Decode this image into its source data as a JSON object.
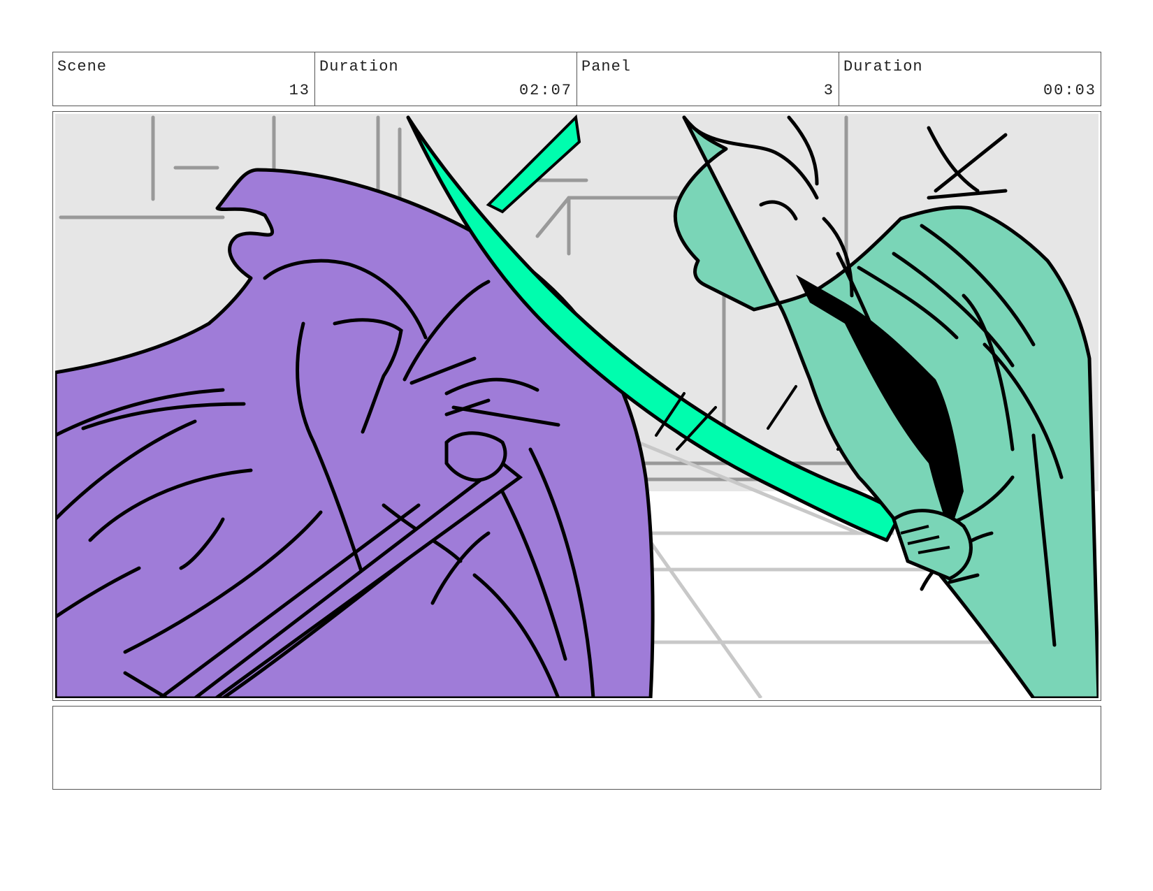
{
  "header": {
    "scene": {
      "label": "Scene",
      "value": "13"
    },
    "scene_duration": {
      "label": "Duration",
      "value": "02:07"
    },
    "panel": {
      "label": "Panel",
      "value": "3"
    },
    "panel_duration": {
      "label": "Duration",
      "value": "00:03"
    }
  },
  "colors": {
    "character_left": "#9f7cd8",
    "character_right": "#7ad5b7",
    "blade": "#00fdae",
    "background_wall": "#e6e6e6",
    "grid_line": "#999999"
  },
  "notes": {
    "text": ""
  }
}
